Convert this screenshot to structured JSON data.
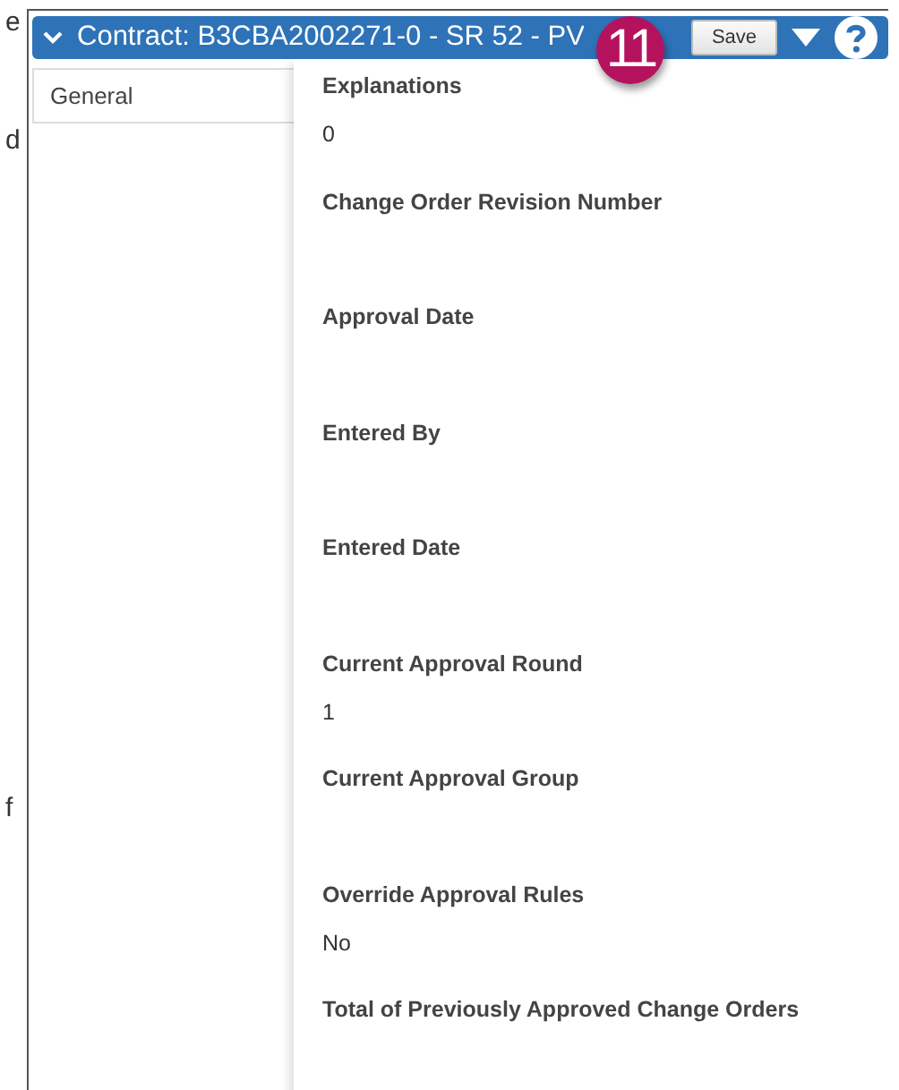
{
  "margin_text": [
    "e",
    "d",
    "f"
  ],
  "header": {
    "title": "Contract: B3CBA2002271-0 - SR 52 - PV",
    "callout_badge": "11",
    "save_button": "Save"
  },
  "tabs": [
    {
      "label": "General",
      "selected": true
    }
  ],
  "fields": [
    {
      "label": "Explanations",
      "value": "0"
    },
    {
      "label": "Change Order Revision Number"
    },
    {
      "label": "Approval Date"
    },
    {
      "label": "Entered By"
    },
    {
      "label": "Entered Date"
    },
    {
      "label": "Current Approval Round",
      "value": "1"
    },
    {
      "label": "Current Approval Group"
    },
    {
      "label": "Override Approval Rules",
      "value": "No"
    },
    {
      "label": "Total of Previously Approved Change Orders"
    }
  ]
}
